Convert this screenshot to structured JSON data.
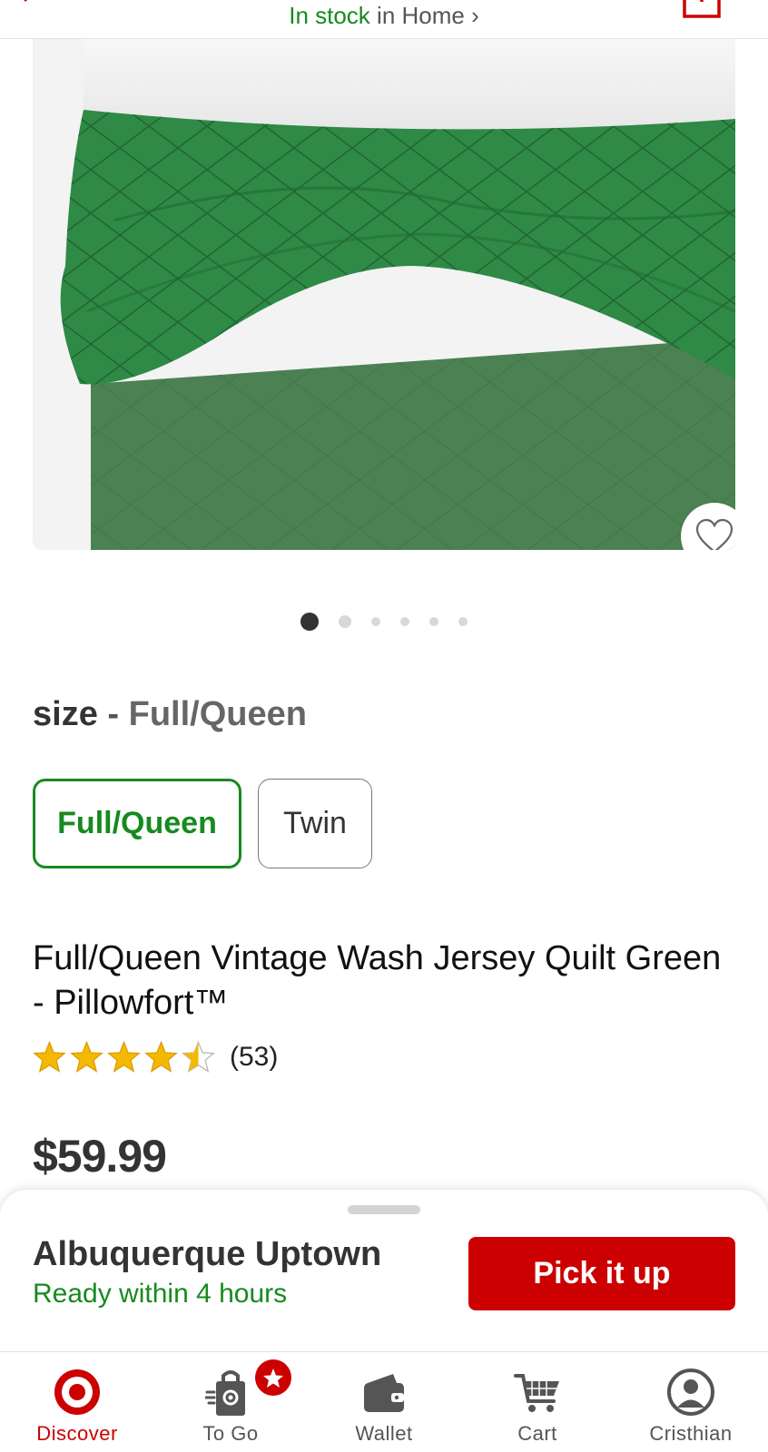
{
  "header": {
    "stock_status": "In stock",
    "stock_location": "in Home",
    "chevron": "›"
  },
  "icons": {
    "back": "back-chevron-icon",
    "share": "share-icon",
    "wishlist": "heart-icon"
  },
  "carousel": {
    "count": 6,
    "active_index": 0
  },
  "size": {
    "label": "size",
    "separator": " - ",
    "selected_value": "Full/Queen",
    "options": [
      {
        "label": "Full/Queen",
        "selected": true
      },
      {
        "label": "Twin",
        "selected": false
      }
    ]
  },
  "product": {
    "title": "Full/Queen Vintage Wash Jersey Quilt Green - Pillowfort™",
    "rating": 4.5,
    "rating_count": "(53)",
    "price": "$59.99"
  },
  "pickup": {
    "store": "Albuquerque Uptown",
    "availability": "Ready within 4 hours",
    "button_label": "Pick it up"
  },
  "tabbar": {
    "items": [
      {
        "label": "Discover",
        "icon": "target-bullseye-icon",
        "active": true
      },
      {
        "label": "To Go",
        "icon": "shopping-bag-icon",
        "active": false
      },
      {
        "label": "Wallet",
        "icon": "wallet-icon",
        "active": false
      },
      {
        "label": "Cart",
        "icon": "cart-icon",
        "active": false
      },
      {
        "label": "Cristhian",
        "icon": "account-icon",
        "active": false
      }
    ]
  },
  "colors": {
    "brand_red": "#cc0000",
    "stock_green": "#178a1f",
    "quilt_green": "#2e7d45"
  }
}
